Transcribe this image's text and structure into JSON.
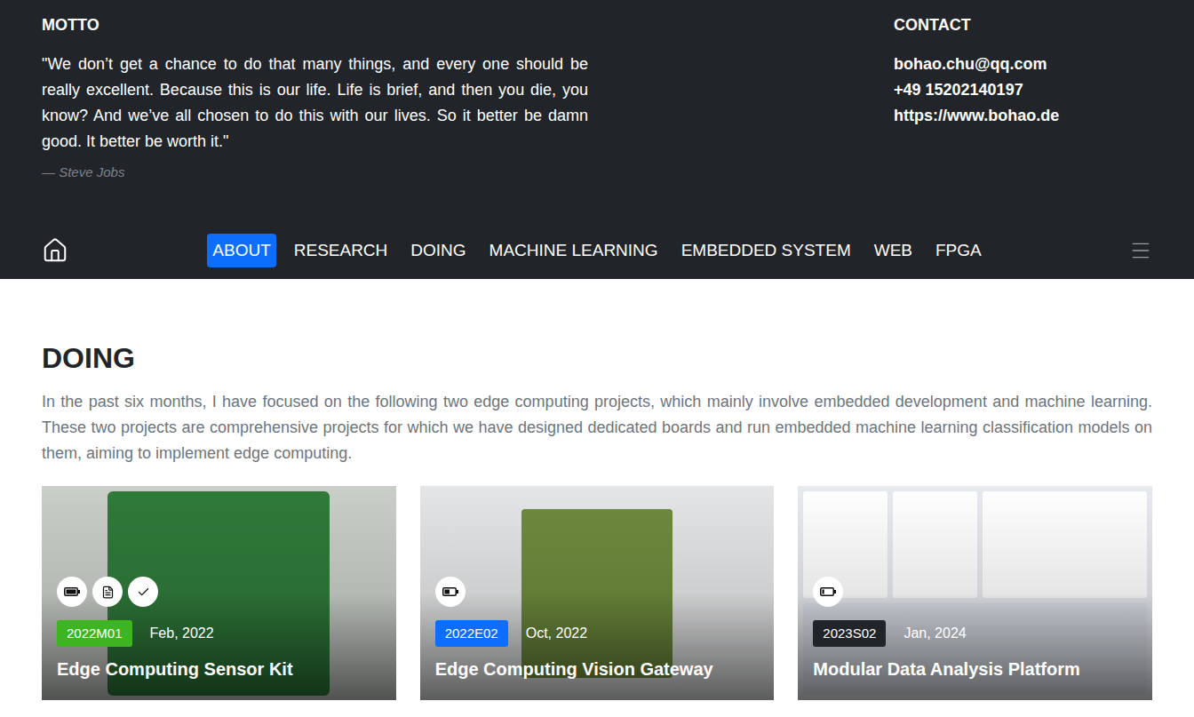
{
  "motto": {
    "heading": "MOTTO",
    "quote": "\"We don’t get a chance to do that many things, and every one should be really excellent. Because this is our life. Life is brief, and then you die, you know? And we’ve all chosen to do this with our lives. So it better be damn good. It better be worth it.\"",
    "author": "— Steve Jobs"
  },
  "contact": {
    "heading": "CONTACT",
    "lines": [
      "bohao.chu@qq.com",
      "+49 15202140197",
      "https://www.bohao.de"
    ]
  },
  "nav": {
    "items": [
      {
        "label": "ABOUT",
        "selected": true
      },
      {
        "label": "RESEARCH",
        "selected": false
      },
      {
        "label": "DOING",
        "selected": false
      },
      {
        "label": "MACHINE LEARNING",
        "selected": false
      },
      {
        "label": "EMBEDDED SYSTEM",
        "selected": false
      },
      {
        "label": "WEB",
        "selected": false
      },
      {
        "label": "FPGA",
        "selected": false
      }
    ]
  },
  "section": {
    "heading": "DOING",
    "description": "In the past six months, I have focused on the following two edge computing projects, which mainly involve embedded development and machine learning. These two projects are comprehensive projects for which we have designed dedicated boards and run embedded machine learning classification models on them, aiming to implement edge computing."
  },
  "cards": [
    {
      "badge": "2022M01",
      "color": "#3cb521",
      "date": "Feb, 2022",
      "title": "Edge Computing Sensor Kit",
      "icons": [
        {
          "kind": "battery",
          "level": 1
        },
        {
          "kind": "pdf"
        },
        {
          "kind": "check"
        }
      ]
    },
    {
      "badge": "2022E02",
      "color": "#0d6efd",
      "date": "Oct, 2022",
      "title": "Edge Computing Vision Gateway",
      "icons": [
        {
          "kind": "battery",
          "level": 0.5
        }
      ]
    },
    {
      "badge": "2023S02",
      "color": "#212529",
      "date": "Jan, 2024",
      "title": "Modular Data Analysis Platform",
      "icons": [
        {
          "kind": "battery",
          "level": 0.2
        }
      ]
    }
  ]
}
